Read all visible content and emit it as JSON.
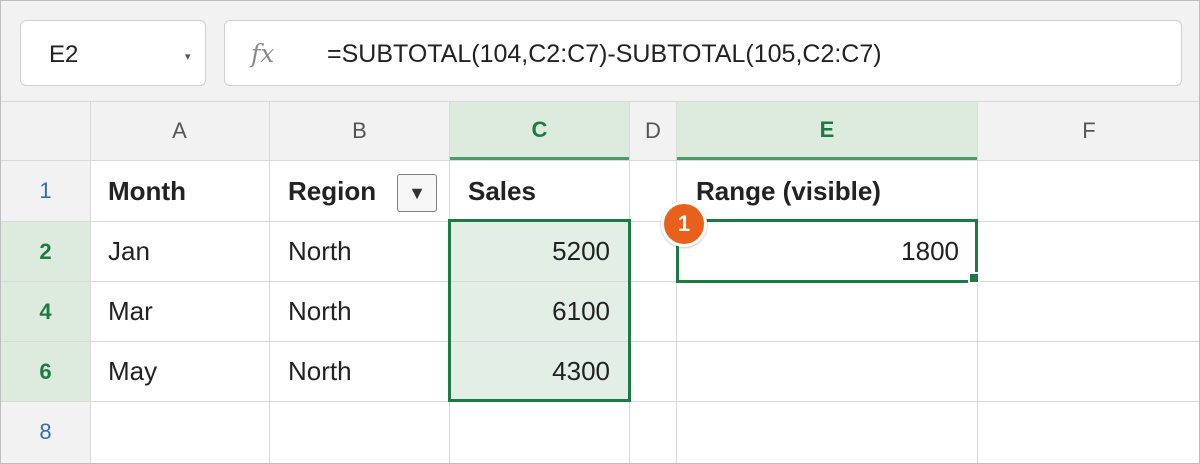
{
  "formula_bar": {
    "name_box": "E2",
    "name_box_caret": "▾",
    "fx_label": "fx",
    "formula": "=SUBTOTAL(104,C2:C7)-SUBTOTAL(105,C2:C7)"
  },
  "columns": [
    "A",
    "B",
    "C",
    "D",
    "E",
    "F"
  ],
  "selected_columns": [
    "C",
    "E"
  ],
  "rows": [
    "1",
    "2",
    "4",
    "6",
    "8"
  ],
  "cells": {
    "A1": "Month",
    "B1": "Region",
    "C1": "Sales",
    "E1": "Range (visible)",
    "A2": "Jan",
    "B2": "North",
    "C2": "5200",
    "E2": "1800",
    "A4": "Mar",
    "B4": "North",
    "C4": "6100",
    "A6": "May",
    "B6": "North",
    "C6": "4300"
  },
  "filter_button_glyph": "▼",
  "callout_badge": "1",
  "colors": {
    "selection_green": "#1e7a43",
    "selection_fill": "#e3efe5",
    "header_selected_fill": "#dcebdd",
    "badge_orange": "#e8601c"
  },
  "icons": {
    "fx": "function-icon",
    "filter": "filter-dropdown-icon",
    "namebox": "chevron-down-icon"
  }
}
